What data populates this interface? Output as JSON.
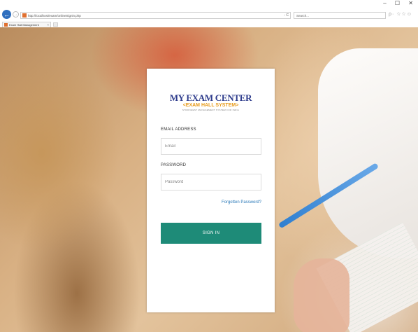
{
  "browser": {
    "url": "http://localhost/exam/onlineSignin.php",
    "address_tools": "- C",
    "search_placeholder": "Search...",
    "right_tools": "ρ· ☆☆☺",
    "window_controls": "– ☐ ✕",
    "tab_title": "Exam Hall Management",
    "tab_close": "×",
    "back_icon": "back-arrow-icon",
    "forward_icon": "forward-arrow-icon"
  },
  "login": {
    "logo_title": "MY EXAM CENTER",
    "logo_subtitle": "<EXAM HALL SYSTEM>",
    "logo_tagline": "STRONGEST MANAGEMENT SYSTEM FOR INDIA",
    "email_label": "EMAIL ADDRESS",
    "email_placeholder": "Email",
    "email_value": "",
    "password_label": "PASSWORD",
    "password_placeholder": "Password",
    "password_value": "",
    "forgot_link": "Forgotten Password?",
    "signin_label": "SIGN IN"
  },
  "colors": {
    "primary_button": "#1e8b78",
    "link": "#2a79b8",
    "logo_title": "#2e3c8c",
    "logo_subtitle": "#e79a1a"
  }
}
